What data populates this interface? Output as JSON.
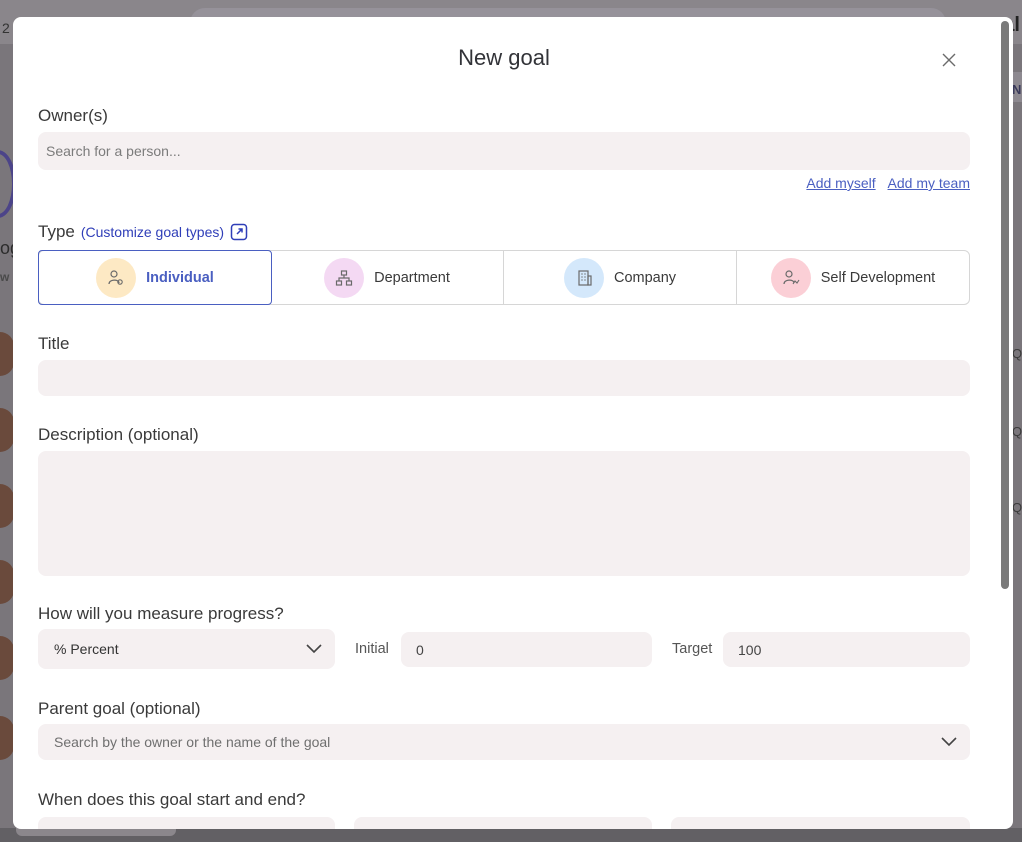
{
  "background": {
    "left_fragment": "2",
    "right_fragment": "al",
    "left_text": "og",
    "left_text2": "w",
    "right_texts": [
      "N",
      "Q",
      "Q",
      "Q"
    ]
  },
  "modal": {
    "title": "New goal",
    "owners": {
      "label": "Owner(s)",
      "placeholder": "Search for a person...",
      "add_myself": "Add myself",
      "add_team": "Add my team"
    },
    "type": {
      "label": "Type",
      "customize_link": "(Customize goal types)",
      "options": [
        {
          "label": "Individual",
          "icon": "person-icon",
          "selected": true,
          "color": "#fde9c4"
        },
        {
          "label": "Department",
          "icon": "org-chart-icon",
          "selected": false,
          "color": "#f4d9f3"
        },
        {
          "label": "Company",
          "icon": "building-icon",
          "selected": false,
          "color": "#d4e8fb"
        },
        {
          "label": "Self Development",
          "icon": "person-growth-icon",
          "selected": false,
          "color": "#fbcfd6"
        }
      ]
    },
    "title_field": {
      "label": "Title",
      "value": ""
    },
    "description": {
      "label": "Description (optional)",
      "value": ""
    },
    "measure": {
      "label": "How will you measure progress?",
      "unit": "% Percent",
      "initial_label": "Initial",
      "initial_value": "0",
      "target_label": "Target",
      "target_value": "100"
    },
    "parent_goal": {
      "label": "Parent goal (optional)",
      "placeholder": "Search by the owner or the name of the goal"
    },
    "dates": {
      "label": "When does this goal start and end?"
    }
  },
  "colors": {
    "accent": "#4a5fc1",
    "field_bg": "#f5f0f1",
    "link": "#4a5fc1"
  }
}
